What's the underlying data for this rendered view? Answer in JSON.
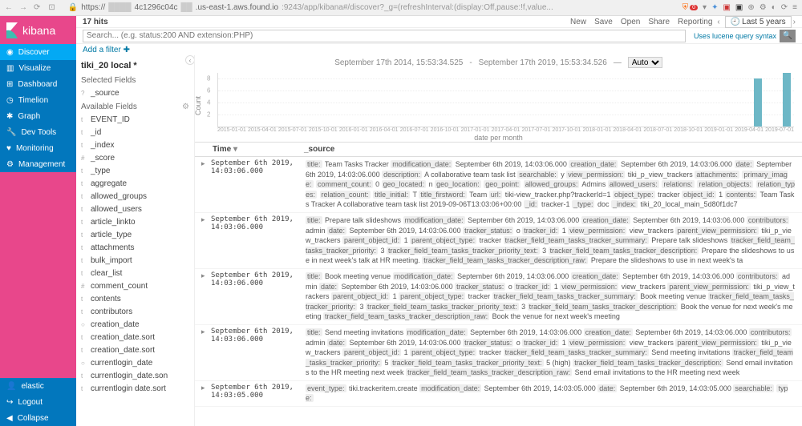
{
  "browser": {
    "url_prefix": "https://",
    "url_mid1": "4c1296c04c",
    "url_mid2": ".us-east-1.aws.found.io",
    "url_path": ":9243/app/kibana#/discover?_g=(refreshInterval:(display:Off,pause:!f,value...",
    "shield_badge": "0"
  },
  "logo": "kibana",
  "nav": [
    {
      "icon": "compass",
      "label": "Discover",
      "active": true
    },
    {
      "icon": "bar",
      "label": "Visualize"
    },
    {
      "icon": "dash",
      "label": "Dashboard"
    },
    {
      "icon": "clock",
      "label": "Timelion"
    },
    {
      "icon": "graph",
      "label": "Graph"
    },
    {
      "icon": "wrench",
      "label": "Dev Tools"
    },
    {
      "icon": "heart",
      "label": "Monitoring"
    },
    {
      "icon": "gear",
      "label": "Management"
    }
  ],
  "nav_bottom": [
    {
      "icon": "user",
      "label": "elastic"
    },
    {
      "icon": "logout",
      "label": "Logout"
    },
    {
      "icon": "collapse",
      "label": "Collapse"
    }
  ],
  "hits": "17 hits",
  "actions": {
    "new": "New",
    "save": "Save",
    "open": "Open",
    "share": "Share",
    "reporting": "Reporting"
  },
  "timepicker": "Last 5 years",
  "search_placeholder": "Search... (e.g. status:200 AND extension:PHP)",
  "lucene": "Uses lucene query syntax",
  "add_filter": "Add a filter",
  "index_pattern": "tiki_20 local *",
  "selected_fields_title": "Selected Fields",
  "selected_fields": [
    {
      "type": "?",
      "name": "_source"
    }
  ],
  "available_fields_title": "Available Fields",
  "available_fields": [
    {
      "type": "t",
      "name": "EVENT_ID"
    },
    {
      "type": "t",
      "name": "_id"
    },
    {
      "type": "t",
      "name": "_index"
    },
    {
      "type": "#",
      "name": "_score"
    },
    {
      "type": "t",
      "name": "_type"
    },
    {
      "type": "t",
      "name": "aggregate"
    },
    {
      "type": "t",
      "name": "allowed_groups"
    },
    {
      "type": "t",
      "name": "allowed_users"
    },
    {
      "type": "t",
      "name": "article_linkto"
    },
    {
      "type": "t",
      "name": "article_type"
    },
    {
      "type": "t",
      "name": "attachments"
    },
    {
      "type": "t",
      "name": "bulk_import"
    },
    {
      "type": "t",
      "name": "clear_list"
    },
    {
      "type": "#",
      "name": "comment_count"
    },
    {
      "type": "t",
      "name": "contents"
    },
    {
      "type": "t",
      "name": "contributors"
    },
    {
      "type": "○",
      "name": "creation_date"
    },
    {
      "type": "t",
      "name": "creation_date.sort"
    },
    {
      "type": "t",
      "name": "creation_date.sort"
    },
    {
      "type": "○",
      "name": "currentlogin_date"
    },
    {
      "type": "t",
      "name": "currentlogin_date.son"
    },
    {
      "type": "t",
      "name": "currentlogin date.sort"
    }
  ],
  "time_range": {
    "from": "September 17th 2014, 15:53:34.525",
    "sep": "-",
    "to": "September 17th 2019, 15:53:34.526",
    "interval": "Auto"
  },
  "chart_data": {
    "type": "bar",
    "ylabel": "Count",
    "xlabel": "date per month",
    "yticks": [
      2,
      4,
      6,
      8
    ],
    "ylim": [
      0,
      9
    ],
    "xticks": [
      "2015-01-01",
      "2015-04-01",
      "2015-07-01",
      "2015-10-01",
      "2016-01-01",
      "2016-04-01",
      "2016-07-01",
      "2016-10-01",
      "2017-01-01",
      "2017-04-01",
      "2017-07-01",
      "2017-10-01",
      "2018-01-01",
      "2018-04-01",
      "2018-07-01",
      "2018-10-01",
      "2019-01-01",
      "2019-04-01",
      "2019-07-01"
    ],
    "bars": [
      {
        "x_pct": 93,
        "value": 8
      },
      {
        "x_pct": 98,
        "value": 9
      }
    ]
  },
  "columns": {
    "time": "Time",
    "source": "_source"
  },
  "docs": [
    {
      "time": "September 6th 2019, 14:03:06.000",
      "source": "<span class=k>title:</span> Team Tasks Tracker <span class=k>modification_date:</span> September 6th 2019, 14:03:06.000 <span class=k>creation_date:</span> September 6th 2019, 14:03:06.000 <span class=k>date:</span> September 6th 2019, 14:03:06.000 <span class=k>description:</span> A collaborative team task list <span class=k>searchable:</span> y <span class=k>view_permission:</span> tiki_p_view_trackers <span class=k>attachments:</span>  <span class=k>primary_image:</span>  <span class=k>comment_count:</span> 0 <span class=k>geo_located:</span> n <span class=k>geo_location:</span>  <span class=k>geo_point:</span>  <span class=k>allowed_groups:</span> Admins <span class=k>allowed_users:</span>  <span class=k>relations:</span>  <span class=k>relation_objects:</span>  <span class=k>relation_types:</span>  <span class=k>relation_count:</span>  <span class=k>title_initial:</span> T <span class=k>title_firstword:</span> Team <span class=k>url:</span> tiki-view_tracker.php?trackerId=1 <span class=k>object_type:</span> tracker <span class=k>object_id:</span> 1 <span class=k>contents:</span>  Team Tasks Tracker A collaborative team task list 2019-09-06T13:03:06+00:00 <span class=k>_id:</span> tracker-1 <span class=k>_type:</span> doc <span class=k>_index:</span> tiki_20_local_main_5d80f1dc7"
    },
    {
      "time": "September 6th 2019, 14:03:06.000",
      "source": "<span class=k>title:</span> Prepare talk slideshows <span class=k>modification_date:</span> September 6th 2019, 14:03:06.000 <span class=k>creation_date:</span> September 6th 2019, 14:03:06.000 <span class=k>contributors:</span> admin <span class=k>date:</span> September 6th 2019, 14:03:06.000 <span class=k>tracker_status:</span> o <span class=k>tracker_id:</span> 1 <span class=k>view_permission:</span> view_trackers <span class=k>parent_view_permission:</span> tiki_p_view_trackers <span class=k>parent_object_id:</span> 1 <span class=k>parent_object_type:</span> tracker <span class=k>tracker_field_team_tasks_tracker_summary:</span> Prepare talk slideshows <span class=k>tracker_field_team_tasks_tracker_priority:</span> 3 <span class=k>tracker_field_team_tasks_tracker_priority_text:</span> 3 <span class=k>tracker_field_team_tasks_tracker_description:</span> Prepare the slideshows to use in next week's talk at HR meeting. <span class=k>tracker_field_team_tasks_tracker_description_raw:</span> Prepare the slideshows to use in next week's ta"
    },
    {
      "time": "September 6th 2019, 14:03:06.000",
      "source": "<span class=k>title:</span> Book meeting venue <span class=k>modification_date:</span> September 6th 2019, 14:03:06.000 <span class=k>creation_date:</span> September 6th 2019, 14:03:06.000 <span class=k>contributors:</span> admin <span class=k>date:</span> September 6th 2019, 14:03:06.000 <span class=k>tracker_status:</span> o <span class=k>tracker_id:</span> 1 <span class=k>view_permission:</span> view_trackers <span class=k>parent_view_permission:</span> tiki_p_view_trackers <span class=k>parent_object_id:</span> 1 <span class=k>parent_object_type:</span> tracker <span class=k>tracker_field_team_tasks_tracker_summary:</span> Book meeting venue <span class=k>tracker_field_team_tasks_tracker_priority:</span> 3 <span class=k>tracker_field_team_tasks_tracker_priority_text:</span> 3 <span class=k>tracker_field_team_tasks_tracker_description:</span> Book the venue for next week's meeting <span class=k>tracker_field_team_tasks_tracker_description_raw:</span> Book the venue for next week's meeting"
    },
    {
      "time": "September 6th 2019, 14:03:06.000",
      "source": "<span class=k>title:</span> Send meeting invitations <span class=k>modification_date:</span> September 6th 2019, 14:03:06.000 <span class=k>creation_date:</span> September 6th 2019, 14:03:06.000 <span class=k>contributors:</span> admin <span class=k>date:</span> September 6th 2019, 14:03:06.000 <span class=k>tracker_status:</span> o <span class=k>tracker_id:</span> 1 <span class=k>view_permission:</span> view_trackers <span class=k>parent_view_permission:</span> tiki_p_view_trackers <span class=k>parent_object_id:</span> 1 <span class=k>parent_object_type:</span> tracker <span class=k>tracker_field_team_tasks_tracker_summary:</span> Send meeting invitations <span class=k>tracker_field_team_tasks_tracker_priority:</span> 5 <span class=k>tracker_field_team_tasks_tracker_priority_text:</span> 5 (high) <span class=k>tracker_field_team_tasks_tracker_description:</span> Send email invitations to the HR meeting next week <span class=k>tracker_field_team_tasks_tracker_description_raw:</span> Send email invitations to the HR meeting next week"
    },
    {
      "time": "September 6th 2019, 14:03:05.000",
      "source": "<span class=k>event_type:</span> tiki.trackeritem.create <span class=k>modification_date:</span> September 6th 2019, 14:03:05.000 <span class=k>date:</span> September 6th 2019, 14:03:05.000 <span class=k>searchable:</span> <span class=k>type:</span>"
    }
  ]
}
